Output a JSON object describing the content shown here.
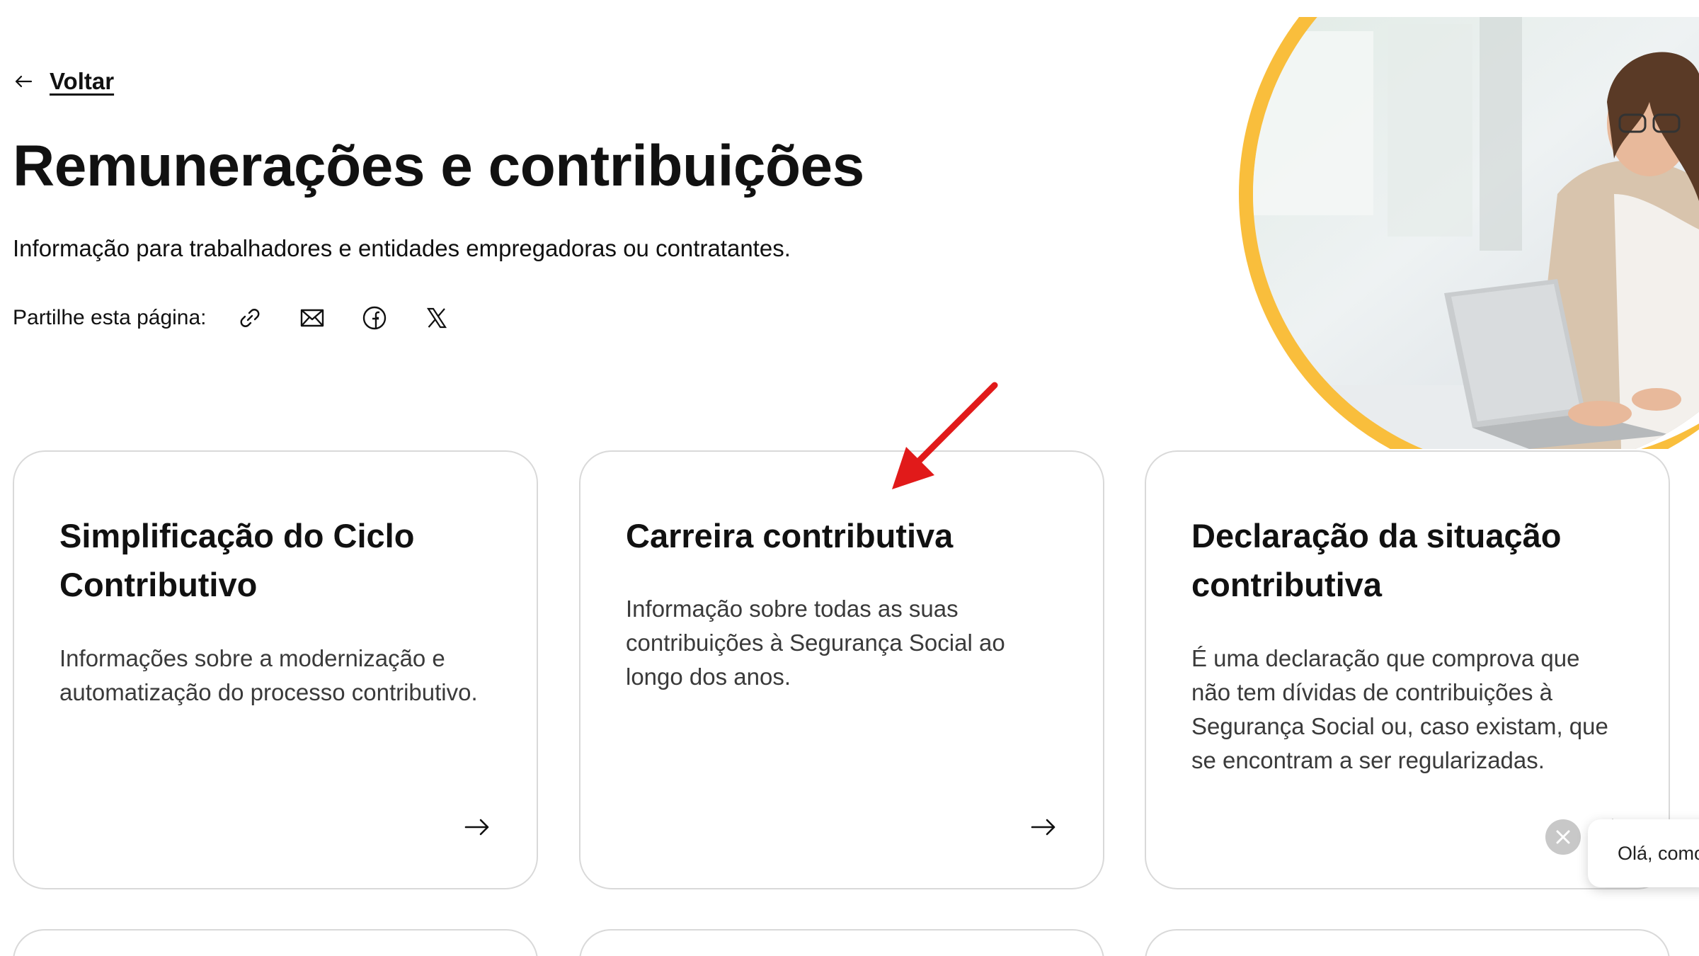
{
  "nav": {
    "back_label": "Voltar"
  },
  "header": {
    "title": "Remunerações e contribuições",
    "subtitle": "Informação para trabalhadores e entidades empregadoras ou contratantes."
  },
  "share": {
    "label": "Partilhe esta página:",
    "buttons": [
      "link-icon",
      "email-icon",
      "facebook-icon",
      "x-icon"
    ]
  },
  "cards": [
    {
      "title": "Simplificação do Ciclo Contributivo",
      "description": "Informações sobre a modernização e automatização do processo contributivo."
    },
    {
      "title": "Carreira contributiva",
      "description": "Informação sobre todas as suas contribuições à Segurança Social ao longo dos anos."
    },
    {
      "title": "Declaração da situação contributiva",
      "description": "É uma declaração que comprova que não tem dívidas de contribuições à Segurança Social ou, caso existam, que se encontram a ser regularizadas."
    }
  ],
  "chat": {
    "greeting": "Olá, como"
  },
  "colors": {
    "accent": "#F9BE3C",
    "annotation": "#E11A1A",
    "border": "#D9D9D9"
  }
}
